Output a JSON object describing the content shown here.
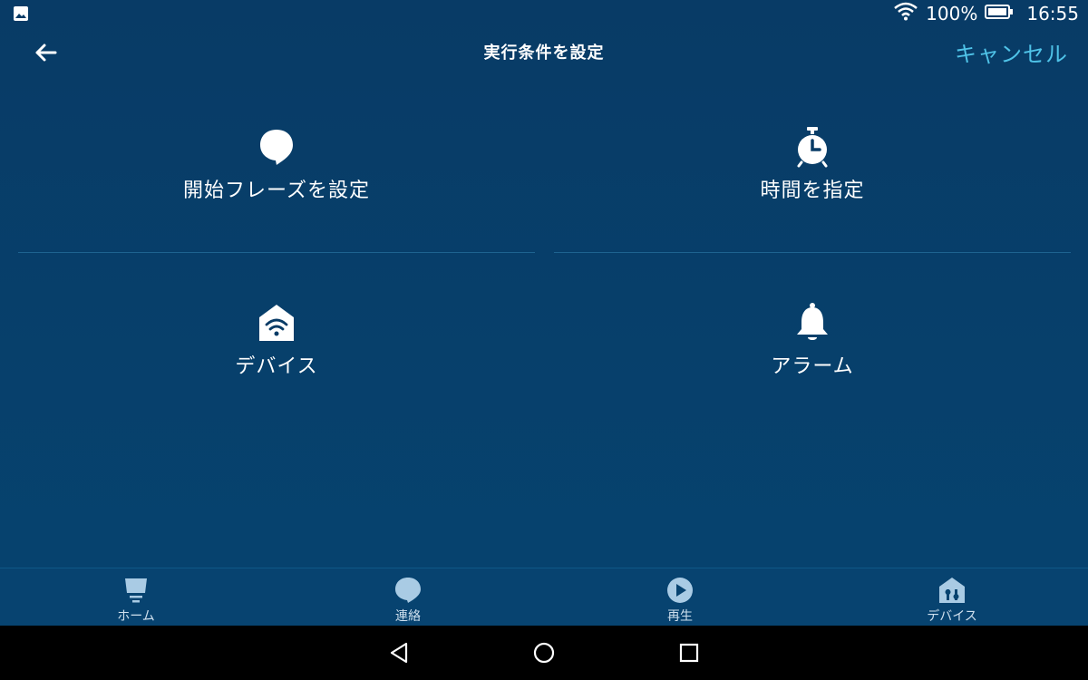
{
  "status_bar": {
    "left_icon": "image-icon",
    "battery": "100%",
    "time": "16:55"
  },
  "header": {
    "title": "実行条件を設定",
    "cancel_label": "キャンセル"
  },
  "options": [
    {
      "label": "開始フレーズを設定",
      "icon": "speech-bubble-icon"
    },
    {
      "label": "時間を指定",
      "icon": "alarm-clock-icon"
    },
    {
      "label": "デバイス",
      "icon": "smart-home-icon"
    },
    {
      "label": "アラーム",
      "icon": "bell-icon"
    }
  ],
  "bottom_nav": {
    "items": [
      {
        "label": "ホーム",
        "icon": "home-icon"
      },
      {
        "label": "連絡",
        "icon": "chat-icon"
      },
      {
        "label": "再生",
        "icon": "play-icon"
      },
      {
        "label": "デバイス",
        "icon": "devices-icon"
      }
    ]
  },
  "colors": {
    "background": "#06436b",
    "accent": "#4fc3e8",
    "nav_icon": "#a9cbe4"
  }
}
